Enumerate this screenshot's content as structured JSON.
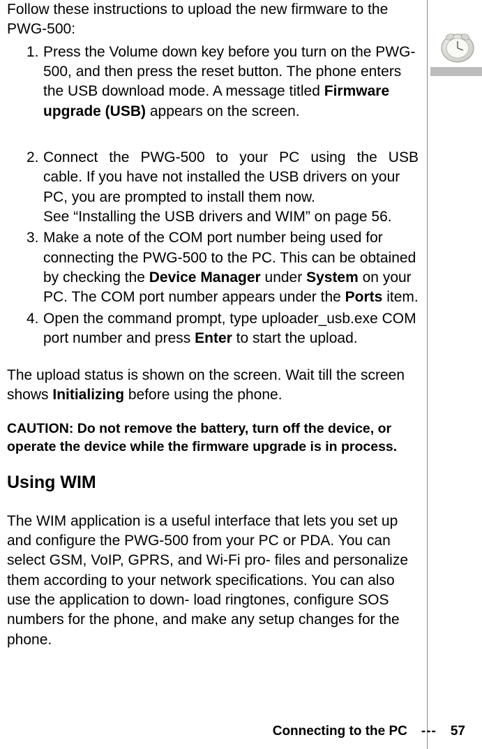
{
  "intro": "Follow these instructions to upload the new firmware to the PWG-500:",
  "step1": {
    "num": "1.",
    "part_a": "Press the Volume down key before you turn on the PWG-500, and then press the reset button. The phone enters the USB download mode. A message titled ",
    "bold": "Firmware upgrade (USB)",
    "part_b": " appears on the screen."
  },
  "step2": {
    "num": "2.",
    "line1": "Connect the PWG-500 to your PC using the USB",
    "rest": "cable. If you have not installed the USB drivers on your PC, you are prompted to install them now.",
    "see": "See “Installing the USB drivers and WIM” on page 56."
  },
  "step3": {
    "num": "3.",
    "a": "Make a note of the COM port number being used for connecting the PWG-500 to the PC. This can be obtained by checking the ",
    "b1": "Device Manager",
    "c": " under ",
    "b2": "System",
    "d": " on your PC. The COM port number appears under the ",
    "b3": "Ports",
    "e": " item."
  },
  "step4": {
    "num": "4.",
    "a": "Open the command prompt, type uploader_usb.exe COM port number and press ",
    "b1": "Enter",
    "b": " to start the upload."
  },
  "status": {
    "a": "The upload status is shown on the screen. Wait till the screen shows ",
    "b1": "Initializing",
    "b": " before using the phone."
  },
  "caution": "CAUTION: Do not remove the battery, turn off the device, or operate the device while the firmware upgrade is in process.",
  "heading": "Using WIM",
  "wim_para": "The WIM application is a useful interface that lets you set up and configure the PWG-500 from your PC or PDA. You can select GSM, VoIP, GPRS, and Wi-Fi pro- files and personalize them according to your network specifications. You can also use the application to down- load ringtones, configure SOS numbers for the phone, and make any setup changes for the phone.",
  "footer": {
    "title": "Connecting to the PC",
    "sep": "---",
    "page": "57"
  }
}
